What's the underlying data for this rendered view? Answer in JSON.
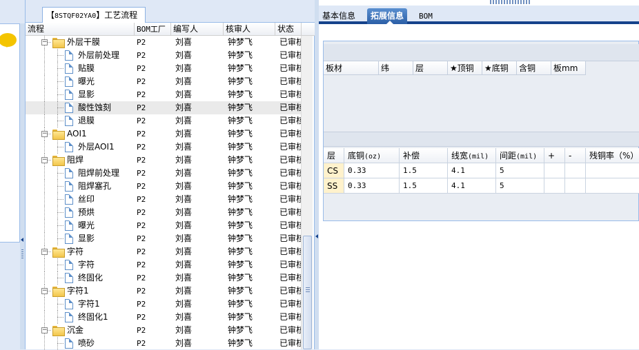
{
  "left_tab": {
    "code": "8STQF02YA0",
    "title": "工艺流程"
  },
  "tree_columns": [
    "流程",
    "BOM工厂",
    "编写人",
    "核审人",
    "状态"
  ],
  "tree_rows": [
    {
      "name": "外层干膜",
      "bom": "P2",
      "writer": "刘喜",
      "reviewer": "钟梦飞",
      "status": "已审核",
      "type": "folder",
      "expanded": true
    },
    {
      "name": "外层前处理",
      "bom": "P2",
      "writer": "刘喜",
      "reviewer": "钟梦飞",
      "status": "已审核",
      "type": "doc"
    },
    {
      "name": "贴膜",
      "bom": "P2",
      "writer": "刘喜",
      "reviewer": "钟梦飞",
      "status": "已审核",
      "type": "doc"
    },
    {
      "name": "曝光",
      "bom": "P2",
      "writer": "刘喜",
      "reviewer": "钟梦飞",
      "status": "已审核",
      "type": "doc"
    },
    {
      "name": "显影",
      "bom": "P2",
      "writer": "刘喜",
      "reviewer": "钟梦飞",
      "status": "已审核",
      "type": "doc"
    },
    {
      "name": "酸性蚀刻",
      "bom": "P2",
      "writer": "刘喜",
      "reviewer": "钟梦飞",
      "status": "已审核",
      "type": "doc",
      "highlight": true
    },
    {
      "name": "退膜",
      "bom": "P2",
      "writer": "刘喜",
      "reviewer": "钟梦飞",
      "status": "已审核",
      "type": "doc"
    },
    {
      "name": "AOI1",
      "bom": "P2",
      "writer": "刘喜",
      "reviewer": "钟梦飞",
      "status": "已审核",
      "type": "folder",
      "expanded": true
    },
    {
      "name": "外层AOI1",
      "bom": "P2",
      "writer": "刘喜",
      "reviewer": "钟梦飞",
      "status": "已审核",
      "type": "doc"
    },
    {
      "name": "阻焊",
      "bom": "P2",
      "writer": "刘喜",
      "reviewer": "钟梦飞",
      "status": "已审核",
      "type": "folder",
      "expanded": true
    },
    {
      "name": "阻焊前处理",
      "bom": "P2",
      "writer": "刘喜",
      "reviewer": "钟梦飞",
      "status": "已审核",
      "type": "doc"
    },
    {
      "name": "阻焊塞孔",
      "bom": "P2",
      "writer": "刘喜",
      "reviewer": "钟梦飞",
      "status": "已审核",
      "type": "doc"
    },
    {
      "name": "丝印",
      "bom": "P2",
      "writer": "刘喜",
      "reviewer": "钟梦飞",
      "status": "已审核",
      "type": "doc"
    },
    {
      "name": "预烘",
      "bom": "P2",
      "writer": "刘喜",
      "reviewer": "钟梦飞",
      "status": "已审核",
      "type": "doc"
    },
    {
      "name": "曝光",
      "bom": "P2",
      "writer": "刘喜",
      "reviewer": "钟梦飞",
      "status": "已审核",
      "type": "doc"
    },
    {
      "name": "显影",
      "bom": "P2",
      "writer": "刘喜",
      "reviewer": "钟梦飞",
      "status": "已审核",
      "type": "doc"
    },
    {
      "name": "字符",
      "bom": "P2",
      "writer": "刘喜",
      "reviewer": "钟梦飞",
      "status": "已审核",
      "type": "folder",
      "expanded": true
    },
    {
      "name": "字符",
      "bom": "P2",
      "writer": "刘喜",
      "reviewer": "钟梦飞",
      "status": "已审核",
      "type": "doc"
    },
    {
      "name": "终固化",
      "bom": "P2",
      "writer": "刘喜",
      "reviewer": "钟梦飞",
      "status": "已审核",
      "type": "doc"
    },
    {
      "name": "字符1",
      "bom": "P2",
      "writer": "刘喜",
      "reviewer": "钟梦飞",
      "status": "已审核",
      "type": "folder",
      "expanded": true
    },
    {
      "name": "字符1",
      "bom": "P2",
      "writer": "刘喜",
      "reviewer": "钟梦飞",
      "status": "已审核",
      "type": "doc"
    },
    {
      "name": "终固化1",
      "bom": "P2",
      "writer": "刘喜",
      "reviewer": "钟梦飞",
      "status": "已审核",
      "type": "doc"
    },
    {
      "name": "沉金",
      "bom": "P2",
      "writer": "刘喜",
      "reviewer": "钟梦飞",
      "status": "已审核",
      "type": "folder",
      "expanded": true
    },
    {
      "name": "喷砂",
      "bom": "P2",
      "writer": "刘喜",
      "reviewer": "钟梦飞",
      "status": "已审核",
      "type": "doc"
    }
  ],
  "right_tabs": [
    {
      "label": "基本信息",
      "active": false
    },
    {
      "label": "拓展信息",
      "active": true
    },
    {
      "label": "BOM",
      "active": false
    }
  ],
  "board_headers": [
    "板材",
    "纬",
    "层",
    "★顶铜",
    "★底铜",
    "含铜",
    "板mm"
  ],
  "copper_headers": [
    "层",
    "底铜(oz)",
    "补偿",
    "线宽(mil)",
    "间距(mil)",
    "+",
    "-",
    "残铜率（%）"
  ],
  "copper_rows": [
    {
      "layer": "CS",
      "base": "0.33",
      "comp": "1.5",
      "width": "4.1",
      "space": "5",
      "plus": "",
      "minus": "",
      "ratio": ""
    },
    {
      "layer": "SS",
      "base": "0.33",
      "comp": "1.5",
      "width": "4.1",
      "space": "5",
      "plus": "",
      "minus": "",
      "ratio": ""
    }
  ],
  "colors": {
    "accent": "#15428b",
    "panel_bg": "#dfe8f6",
    "border": "#99bbe8",
    "folder": "#f2c54b",
    "chat": "#f4c400"
  },
  "icons": {
    "folder": "folder-icon",
    "document": "document-icon",
    "chat": "chat-bubble-icon"
  }
}
